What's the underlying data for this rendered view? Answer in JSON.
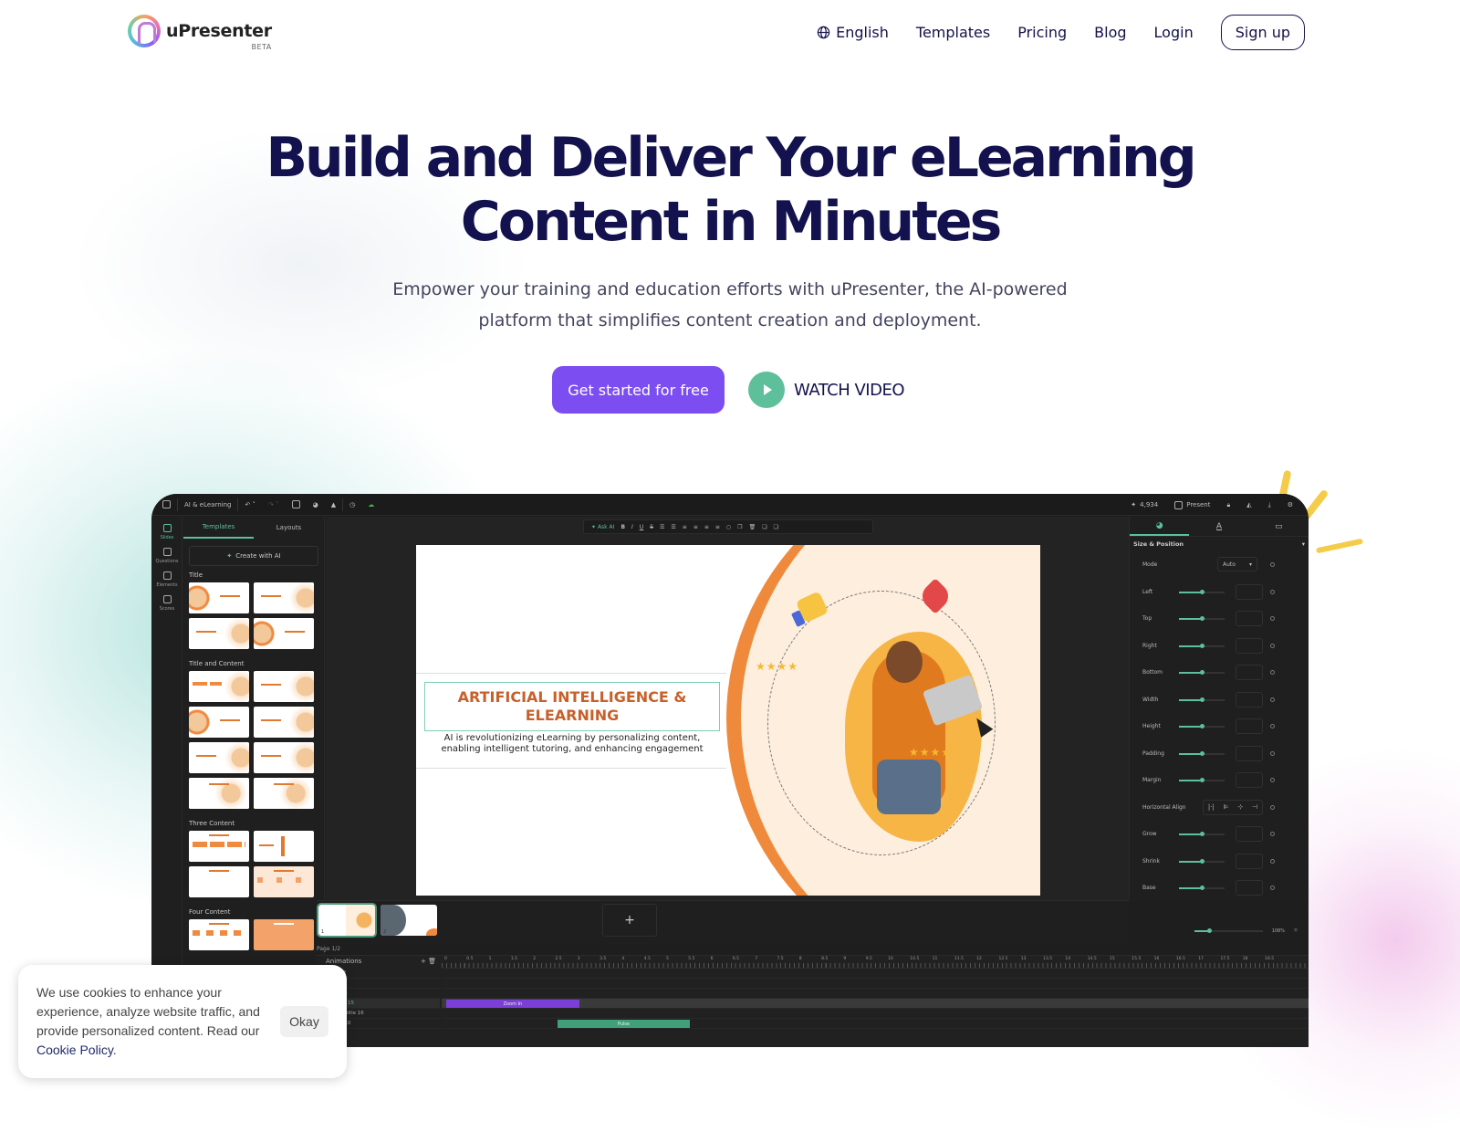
{
  "header": {
    "logo_text": "uPresenter",
    "logo_badge": "BETA",
    "nav": [
      {
        "label": "English",
        "icon": "globe-icon"
      },
      {
        "label": "Templates"
      },
      {
        "label": "Pricing"
      },
      {
        "label": "Blog"
      },
      {
        "label": "Login"
      }
    ],
    "signup_label": "Sign up"
  },
  "hero": {
    "title_line1": "Build and Deliver Your eLearning",
    "title_line2": "Content in Minutes",
    "subtitle_line1": "Empower your training and education efforts with uPresenter, the AI-powered",
    "subtitle_line2": "platform that simplifies content creation and deployment.",
    "cta_primary": "Get started for free",
    "cta_video": "WATCH VIDEO"
  },
  "colors": {
    "primary": "#7c4df0",
    "accent_green": "#5ebf9b",
    "heading": "#13124e",
    "editor_bg": "#1e1e1e",
    "slide_orange": "#ef8a3c"
  },
  "editor": {
    "topbar": {
      "project_name": "AI & eLearning",
      "credits": "4,934",
      "present_label": "Present"
    },
    "rail": [
      {
        "label": "Slides",
        "active": true
      },
      {
        "label": "Questions"
      },
      {
        "label": "Elements"
      },
      {
        "label": "Scores"
      }
    ],
    "panel": {
      "tabs": [
        "Templates",
        "Layouts"
      ],
      "create_ai_label": "Create with AI",
      "sections": [
        {
          "label": "Title"
        },
        {
          "label": "Title and Content"
        },
        {
          "label": "Three Content"
        },
        {
          "label": "Four Content"
        }
      ]
    },
    "format_toolbar": {
      "ask_ai_label": "Ask AI",
      "buttons": [
        "B",
        "I",
        "U",
        "S"
      ]
    },
    "slide": {
      "title": "ARTIFICIAL INTELLIGENCE & ELEARNING",
      "body": "AI is revolutionizing eLearning by personalizing content, enabling intelligent tutoring, and enhancing engagement",
      "stars": "★★★★"
    },
    "thumbnails": [
      {
        "number": "1"
      },
      {
        "number": "2"
      }
    ],
    "add_slide_label": "+",
    "page_info": "Page 1/2",
    "zoom_level": "108%",
    "right_panel": {
      "section_title": "Size & Position",
      "mode_label": "Mode",
      "mode_value": "Auto",
      "properties": [
        {
          "label": "Left",
          "value": 0.5
        },
        {
          "label": "Top",
          "value": 0.5
        },
        {
          "label": "Right",
          "value": 0.5
        },
        {
          "label": "Bottom",
          "value": 0.5
        },
        {
          "label": "Width",
          "value": 0.5
        },
        {
          "label": "Height",
          "value": 0.5
        },
        {
          "label": "Padding",
          "value": 0.5
        },
        {
          "label": "Margin",
          "value": 0.5
        }
      ],
      "align_label": "Horizontal Align",
      "properties2": [
        {
          "label": "Grow",
          "value": 0.5
        },
        {
          "label": "Shrink",
          "value": 0.5
        },
        {
          "label": "Base",
          "value": 0.5
        }
      ]
    },
    "timeline": {
      "header": "Animations",
      "ruler": [
        "0",
        "0.5",
        "1",
        "1.5",
        "2",
        "2.5",
        "3",
        "3.5",
        "4",
        "4.5",
        "5",
        "5.5",
        "6",
        "6.5",
        "7",
        "7.5",
        "8",
        "8.5",
        "9",
        "9.5",
        "10",
        "10.5",
        "11",
        "11.5",
        "12",
        "12.5",
        "13",
        "13.5",
        "14",
        "14.5",
        "15",
        "15.5",
        "16",
        "16.5",
        "17",
        "17.5",
        "18",
        "18.5"
      ],
      "rows": [
        {
          "label": "...12"
        },
        {
          "label": ""
        },
        {
          "label": "...p 1"
        },
        {
          "label": "...tle 15",
          "highlight": true
        },
        {
          "label": "...ubtitle 16"
        },
        {
          "label": "...e 10"
        }
      ],
      "bars": [
        {
          "label": "Zoom In",
          "row": 3,
          "start": 0,
          "end": 3,
          "color": "#7b3fd8"
        },
        {
          "label": "Pulse",
          "row": 5,
          "start": 2.5,
          "end": 5.5,
          "color": "#3fa07a"
        }
      ]
    }
  },
  "cookie": {
    "text": "We use cookies to enhance your experience, analyze website traffic, and provide personalized content. Read our ",
    "link": "Cookie Policy",
    "after_link": ".",
    "button": "Okay"
  }
}
